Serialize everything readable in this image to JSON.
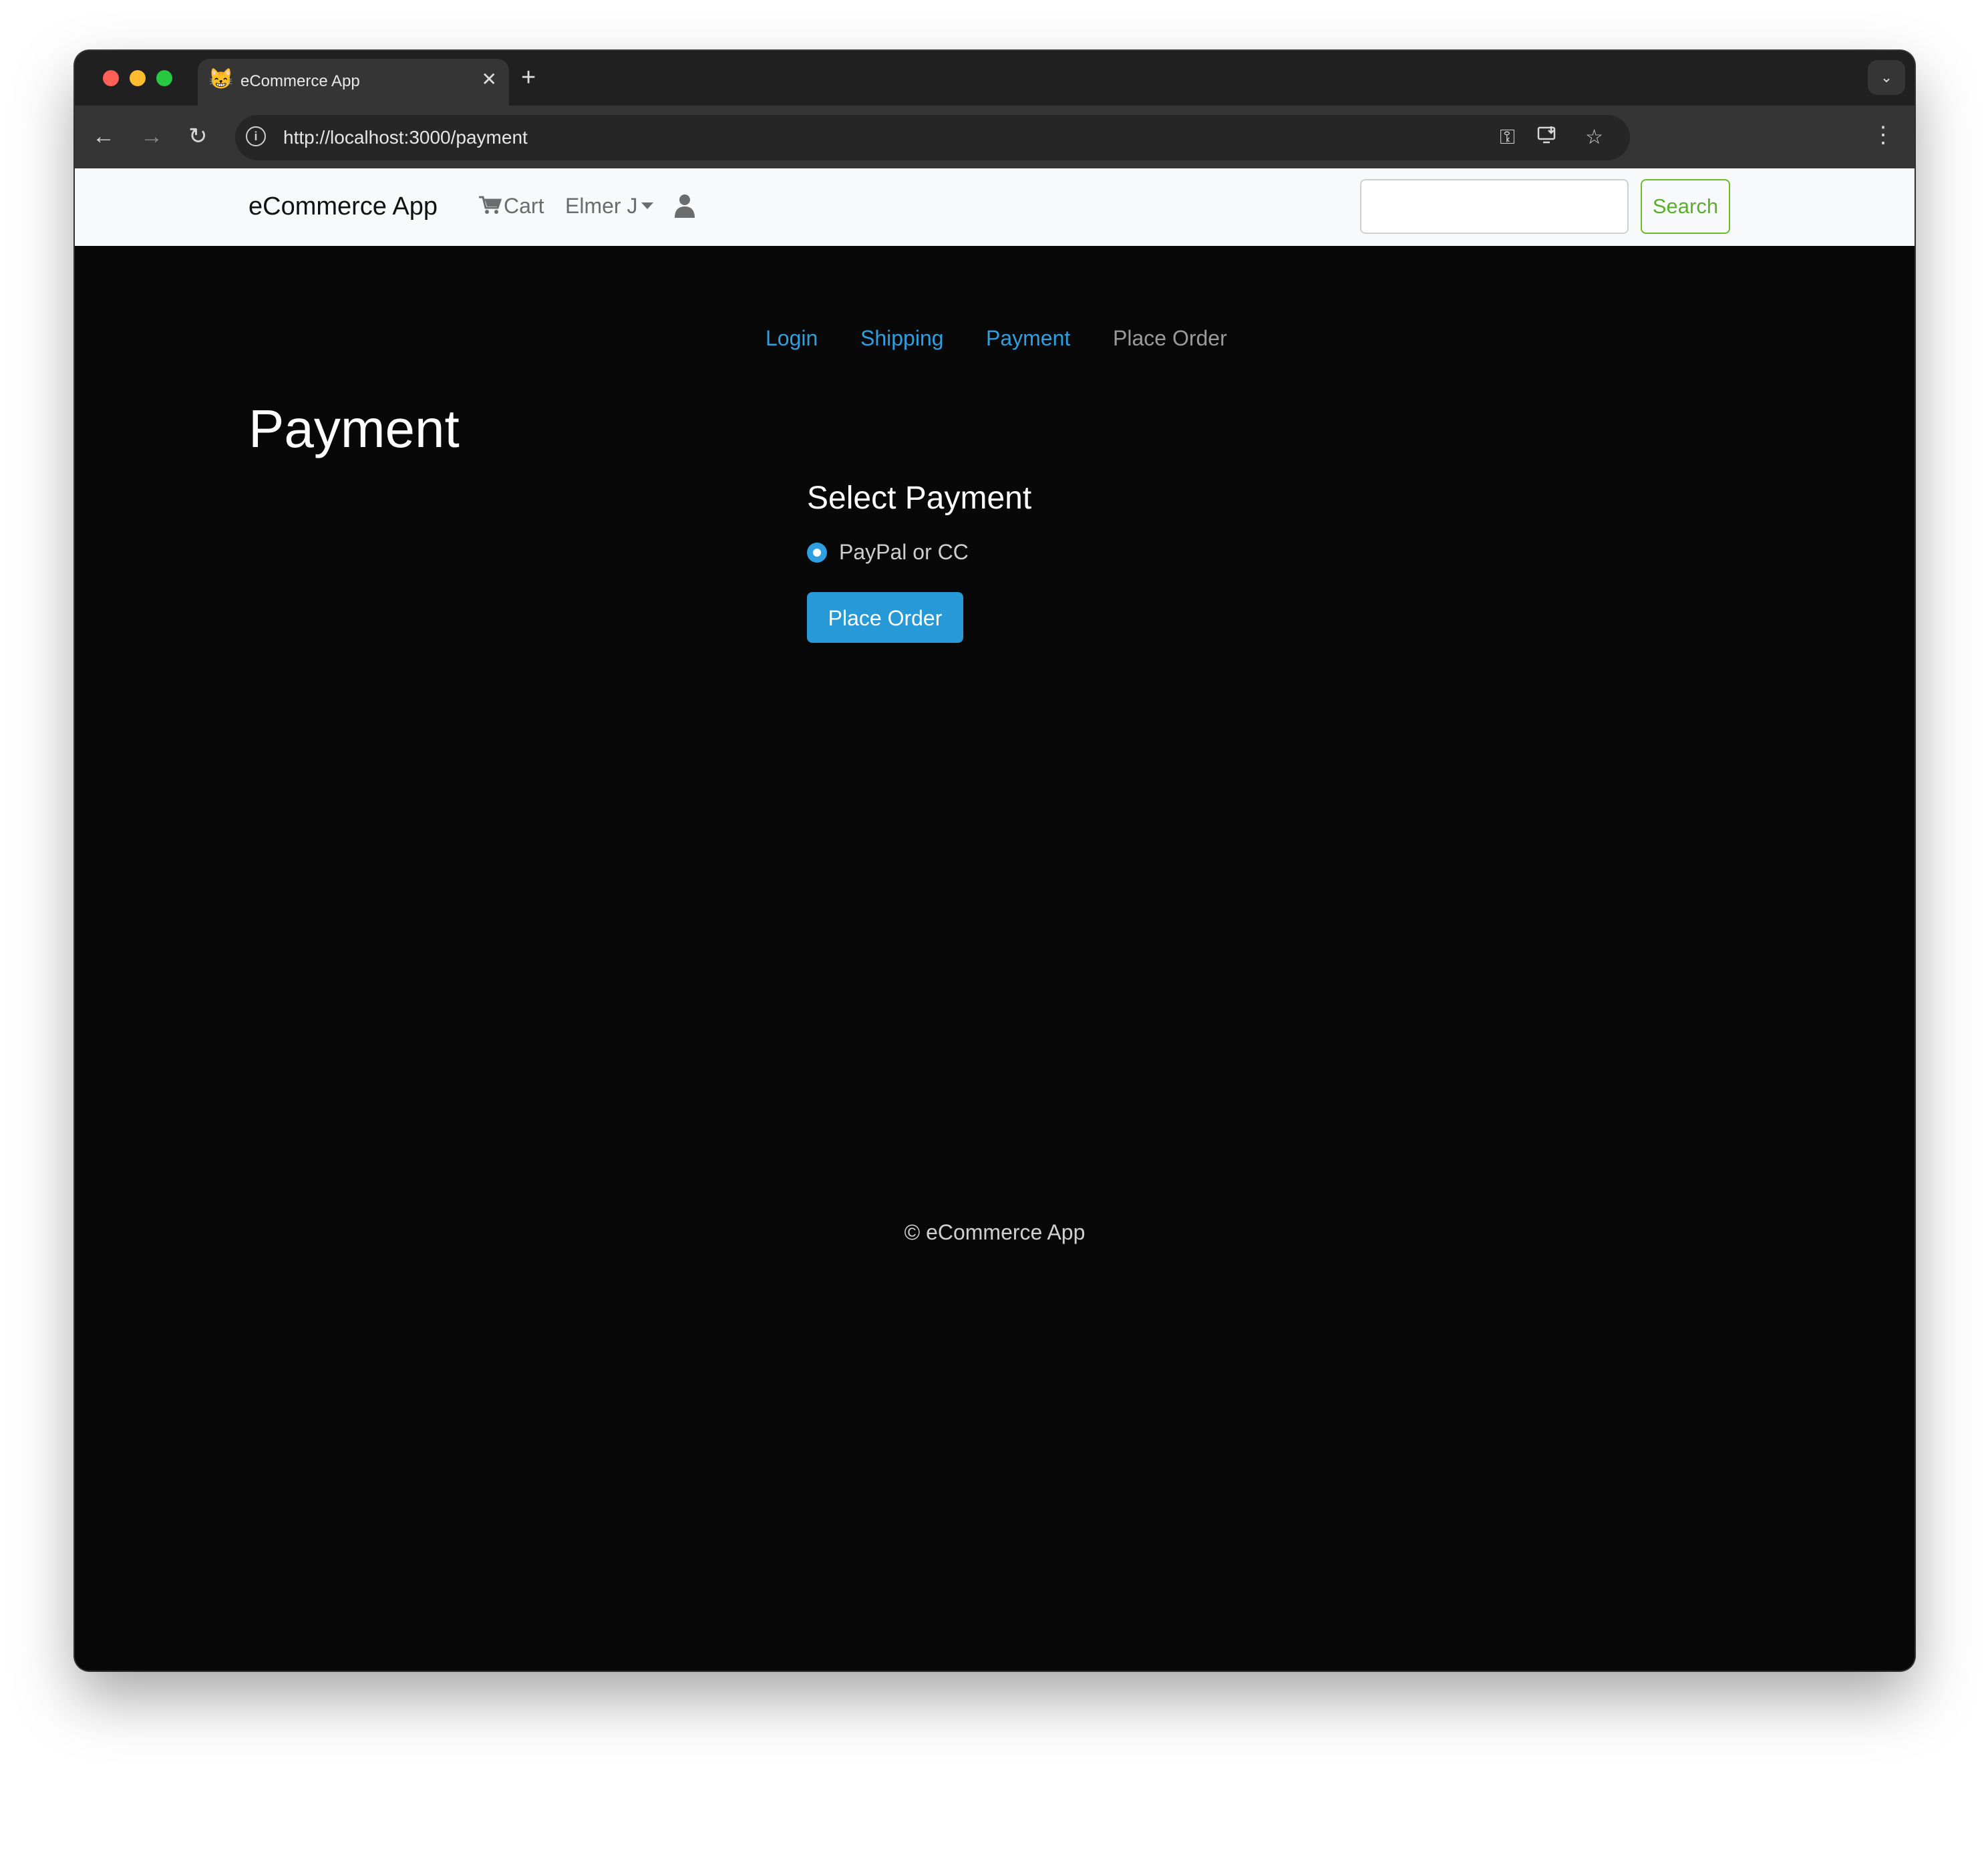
{
  "browser": {
    "tab_title": "eCommerce App",
    "favicon": "😸",
    "url": "http://localhost:3000/payment"
  },
  "navbar": {
    "brand": "eCommerce App",
    "cart_label": "Cart",
    "user_name": "Elmer J",
    "search_placeholder": "",
    "search_button": "Search"
  },
  "checkout_steps": [
    {
      "label": "Login",
      "state": "active"
    },
    {
      "label": "Shipping",
      "state": "active"
    },
    {
      "label": "Payment",
      "state": "active"
    },
    {
      "label": "Place Order",
      "state": "disabled"
    }
  ],
  "page": {
    "title": "Payment",
    "form_title": "Select Payment",
    "payment_option": "PayPal or CC",
    "payment_selected": true,
    "submit_label": "Place Order"
  },
  "footer": {
    "text": "© eCommerce App"
  },
  "colors": {
    "link": "#2e9fe0",
    "primary_button": "#2699d6",
    "search_outline": "#6cbd2a",
    "page_background": "#080808"
  }
}
